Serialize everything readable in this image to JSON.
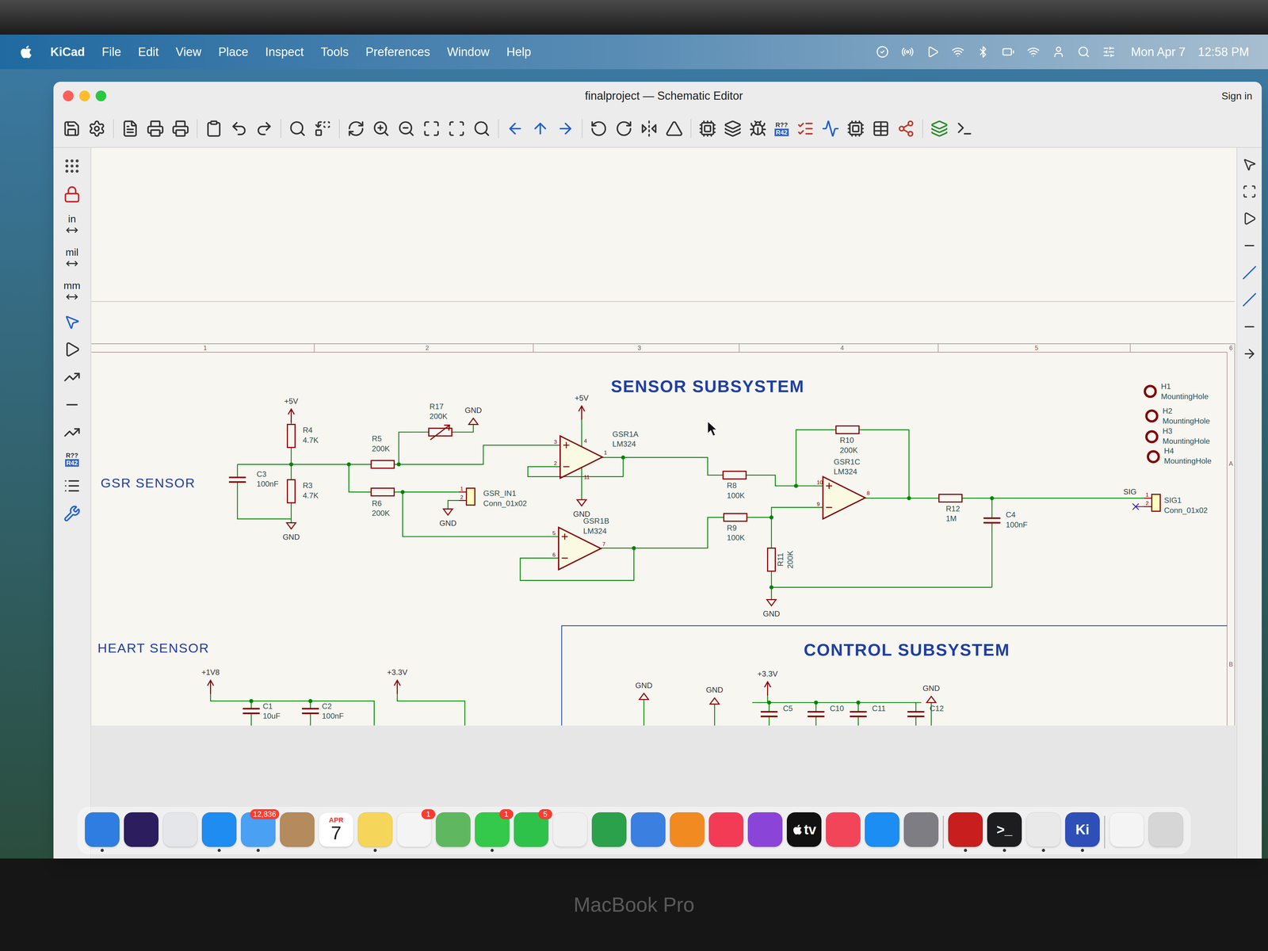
{
  "menubar": {
    "app": "KiCad",
    "menus": [
      "File",
      "Edit",
      "View",
      "Place",
      "Inspect",
      "Tools",
      "Preferences",
      "Window",
      "Help"
    ],
    "date": "Mon Apr 7",
    "time": "12:58 PM"
  },
  "window": {
    "title": "finalproject — Schematic Editor",
    "sign_in": "Sign in"
  },
  "annotate_icon": {
    "top": "R??",
    "bottom": "R42"
  },
  "left_toolbar": {
    "units": [
      {
        "label": "in",
        "selected": false
      },
      {
        "label": "mil",
        "selected": false
      },
      {
        "label": "mm",
        "selected": false
      }
    ]
  },
  "schematic": {
    "column_numbers": [
      "1",
      "2",
      "3",
      "4",
      "5",
      "6"
    ],
    "row_letters": [
      "A",
      "B"
    ],
    "sheet_titles": [
      "SENSOR SUBSYSTEM",
      "CONTROL SUBSYSTEM"
    ],
    "section_labels": [
      "GSR SENSOR",
      "HEART SENSOR"
    ],
    "net_labels": [
      "SIG"
    ],
    "power_symbols": [
      {
        "label": "+5V",
        "kind": "supply"
      },
      {
        "label": "GND",
        "kind": "ground"
      },
      {
        "label": "GND",
        "kind": "ground-inverted"
      },
      {
        "label": "+5V",
        "kind": "supply"
      },
      {
        "label": "GND",
        "kind": "ground"
      },
      {
        "label": "GND",
        "kind": "ground"
      },
      {
        "label": "GND",
        "kind": "ground"
      },
      {
        "label": "+1V8",
        "kind": "supply"
      },
      {
        "label": "+3.3V",
        "kind": "supply"
      },
      {
        "label": "GND",
        "kind": "ground-inverted"
      },
      {
        "label": "GND",
        "kind": "ground-inverted"
      },
      {
        "label": "+3.3V",
        "kind": "supply"
      },
      {
        "label": "GND",
        "kind": "ground-inverted"
      }
    ],
    "components": [
      {
        "ref": "R4",
        "value": "4.7K",
        "kind": "resistor"
      },
      {
        "ref": "R3",
        "value": "4.7K",
        "kind": "resistor"
      },
      {
        "ref": "C3",
        "value": "100nF",
        "kind": "capacitor"
      },
      {
        "ref": "R5",
        "value": "200K",
        "kind": "resistor"
      },
      {
        "ref": "R17",
        "value": "200K",
        "kind": "potentiometer"
      },
      {
        "ref": "R6",
        "value": "200K",
        "kind": "resistor"
      },
      {
        "ref": "GSR_IN1",
        "value": "Conn_01x02",
        "kind": "connector",
        "pins": [
          "1",
          "2"
        ]
      },
      {
        "ref": "GSR1A",
        "value": "LM324",
        "kind": "opamp",
        "pins": [
          "3",
          "2",
          "1",
          "4",
          "11"
        ]
      },
      {
        "ref": "GSR1B",
        "value": "LM324",
        "kind": "opamp",
        "pins": [
          "5",
          "6",
          "7"
        ]
      },
      {
        "ref": "R8",
        "value": "100K",
        "kind": "resistor"
      },
      {
        "ref": "R9",
        "value": "100K",
        "kind": "resistor"
      },
      {
        "ref": "R11",
        "value": "200K",
        "kind": "resistor"
      },
      {
        "ref": "R10",
        "value": "200K",
        "kind": "resistor"
      },
      {
        "ref": "GSR1C",
        "value": "LM324",
        "kind": "opamp",
        "pins": [
          "10",
          "9",
          "8"
        ]
      },
      {
        "ref": "R12",
        "value": "1M",
        "kind": "resistor"
      },
      {
        "ref": "C4",
        "value": "100nF",
        "kind": "capacitor"
      },
      {
        "ref": "SIG1",
        "value": "Conn_01x02",
        "kind": "connector",
        "pins": [
          "1",
          "2"
        ]
      },
      {
        "ref": "H1",
        "value": "MountingHole",
        "kind": "mounting-hole"
      },
      {
        "ref": "H2",
        "value": "MountingHole",
        "kind": "mounting-hole"
      },
      {
        "ref": "H3",
        "value": "MountingHole",
        "kind": "mounting-hole"
      },
      {
        "ref": "H4",
        "value": "MountingHole",
        "kind": "mounting-hole"
      },
      {
        "ref": "C1",
        "value": "10uF",
        "kind": "capacitor"
      },
      {
        "ref": "C2",
        "value": "100nF",
        "kind": "capacitor"
      },
      {
        "ref": "C5",
        "kind": "capacitor"
      },
      {
        "ref": "C10",
        "kind": "capacitor"
      },
      {
        "ref": "C11",
        "kind": "capacitor"
      },
      {
        "ref": "C12",
        "kind": "capacitor"
      }
    ]
  },
  "dock": [
    {
      "kind": "app",
      "color": "#2f7de1",
      "running": true
    },
    {
      "kind": "app",
      "color": "#2b1d5e",
      "running": false
    },
    {
      "kind": "app",
      "color": "#e4e6ea",
      "running": false
    },
    {
      "kind": "app",
      "color": "#1e8cf0",
      "running": true
    },
    {
      "kind": "app",
      "color": "#4aa0f2",
      "running": true,
      "badge": "12,836"
    },
    {
      "kind": "app",
      "color": "#b38b5d",
      "running": false
    },
    {
      "kind": "calendar",
      "color": "#ffffff",
      "running": false,
      "month": "APR",
      "day": "7"
    },
    {
      "kind": "app",
      "color": "#f5d65a",
      "running": true
    },
    {
      "kind": "app",
      "color": "#f4f4f4",
      "running": false,
      "badge": "1"
    },
    {
      "kind": "app",
      "color": "#5fb860",
      "running": false
    },
    {
      "kind": "app",
      "color": "#34c94a",
      "running": true,
      "badge": "1"
    },
    {
      "kind": "app",
      "color": "#2fc24a",
      "running": false,
      "badge": "5"
    },
    {
      "kind": "app",
      "color": "#f0f0f0",
      "running": false
    },
    {
      "kind": "app",
      "color": "#2aa14a",
      "running": false
    },
    {
      "kind": "app",
      "color": "#3b7fe0",
      "running": false
    },
    {
      "kind": "app",
      "color": "#f28a22",
      "running": false
    },
    {
      "kind": "app",
      "color": "#f43b55",
      "running": false
    },
    {
      "kind": "app",
      "color": "#8b44d8",
      "running": false
    },
    {
      "kind": "app",
      "color": "#111111",
      "running": false,
      "glyph": "tv"
    },
    {
      "kind": "app",
      "color": "#f3455a",
      "running": false
    },
    {
      "kind": "app",
      "color": "#1c8df2",
      "running": false
    },
    {
      "kind": "app",
      "color": "#7d7d83",
      "running": false
    },
    {
      "kind": "separator"
    },
    {
      "kind": "app",
      "color": "#c81e1e",
      "running": true
    },
    {
      "kind": "app",
      "color": "#1d1d1f",
      "running": true,
      "glyph": ">_"
    },
    {
      "kind": "app",
      "color": "#e9e9e9",
      "running": true
    },
    {
      "kind": "app",
      "color": "#2e4fb8",
      "running": true,
      "glyph": "Ki"
    },
    {
      "kind": "separator"
    },
    {
      "kind": "app",
      "color": "#f4f4f4",
      "running": false
    },
    {
      "kind": "app",
      "color": "#d6d6d6",
      "running": false
    }
  ],
  "bezel": {
    "label": "MacBook Pro"
  }
}
